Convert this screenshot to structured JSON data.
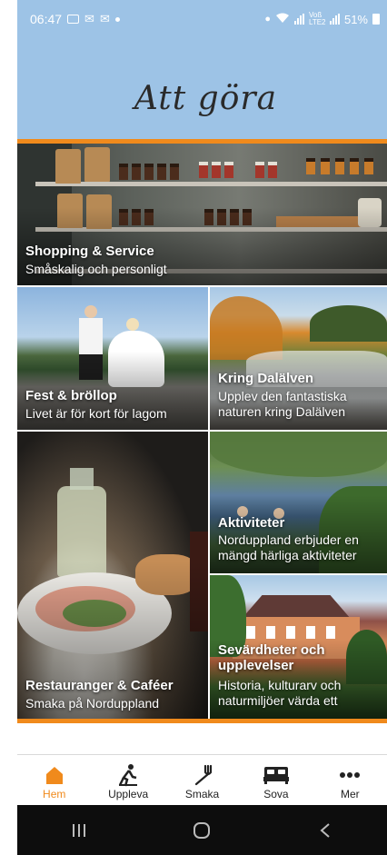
{
  "status_bar": {
    "time": "06:47",
    "network_label": "Voß LTE2",
    "battery": "51%"
  },
  "header": {
    "title": "Att göra"
  },
  "tiles": [
    {
      "id": "shopping",
      "title": "Shopping & Service",
      "subtitle": "Småskalig och personligt"
    },
    {
      "id": "fest",
      "title": "Fest & bröllop",
      "subtitle": "Livet är för kort för lagom"
    },
    {
      "id": "dalalven",
      "title": "Kring Dalälven",
      "subtitle": "Upplev den fantastiska naturen kring Dalälven"
    },
    {
      "id": "restauranger",
      "title": "Restauranger & Caféer",
      "subtitle": "Smaka på Norduppland"
    },
    {
      "id": "aktiviteter",
      "title": "Aktiviteter",
      "subtitle": "Norduppland erbjuder en mängd härliga aktiviteter"
    },
    {
      "id": "sevardheter",
      "title": "Sevärdheter och upplevelser",
      "subtitle": "Historia, kulturarv och naturmiljöer värda ett"
    }
  ],
  "bottom_nav": [
    {
      "label": "Hem",
      "icon": "home-icon",
      "active": true
    },
    {
      "label": "Uppleva",
      "icon": "hiker-icon",
      "active": false
    },
    {
      "label": "Smaka",
      "icon": "fork-icon",
      "active": false
    },
    {
      "label": "Sova",
      "icon": "bed-icon",
      "active": false
    },
    {
      "label": "Mer",
      "icon": "more-dots-icon",
      "active": false
    }
  ],
  "colors": {
    "accent": "#f08a1c",
    "header_bg": "#9dc3e6"
  }
}
